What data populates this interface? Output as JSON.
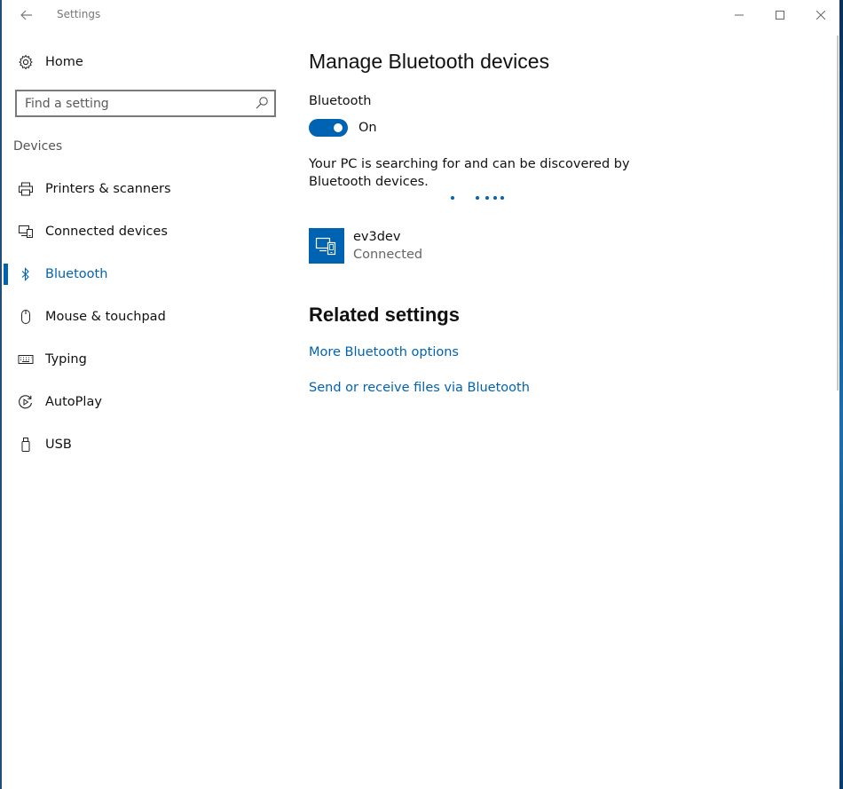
{
  "window": {
    "title": "Settings",
    "controls": {
      "minimize": "—",
      "maximize": "☐",
      "close": "✕"
    }
  },
  "sidebar": {
    "home_label": "Home",
    "search": {
      "placeholder": "Find a setting",
      "value": ""
    },
    "section_label": "Devices",
    "items": [
      {
        "label": "Printers & scanners",
        "icon": "printer-icon",
        "active": false
      },
      {
        "label": "Connected devices",
        "icon": "connected-devices-icon",
        "active": false
      },
      {
        "label": "Bluetooth",
        "icon": "bluetooth-icon",
        "active": true
      },
      {
        "label": "Mouse & touchpad",
        "icon": "mouse-icon",
        "active": false
      },
      {
        "label": "Typing",
        "icon": "keyboard-icon",
        "active": false
      },
      {
        "label": "AutoPlay",
        "icon": "autoplay-icon",
        "active": false
      },
      {
        "label": "USB",
        "icon": "usb-icon",
        "active": false
      }
    ]
  },
  "main": {
    "title": "Manage Bluetooth devices",
    "bluetooth_label": "Bluetooth",
    "toggle_state": "On",
    "toggle_on": true,
    "status_message": "Your PC is searching for and can be discovered by Bluetooth devices.",
    "devices": [
      {
        "name": "ev3dev",
        "status": "Connected",
        "icon": "device-pc-phone-icon"
      }
    ],
    "related_title": "Related settings",
    "links": [
      "More Bluetooth options",
      "Send or receive files via Bluetooth"
    ]
  },
  "colors": {
    "accent": "#0063b1",
    "text": "#111111",
    "secondary_text": "#666666"
  }
}
